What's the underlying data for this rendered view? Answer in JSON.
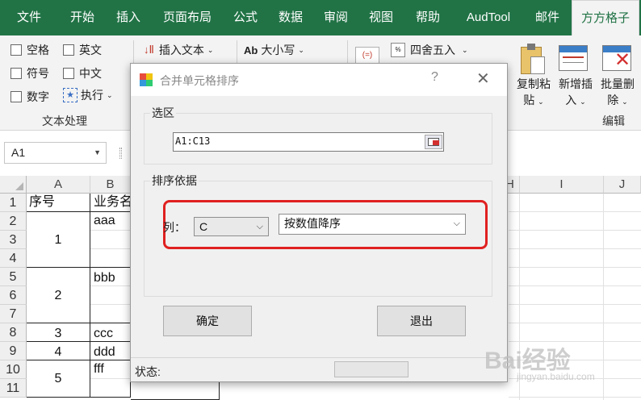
{
  "tabs": [
    "文件",
    "开始",
    "插入",
    "页面布局",
    "公式",
    "数据",
    "审阅",
    "视图",
    "帮助",
    "AudTool",
    "邮件",
    "方方格子"
  ],
  "ribbon": {
    "checkboxes": [
      "空格",
      "英文",
      "符号",
      "中文",
      "数字"
    ],
    "execute_label": "执行",
    "group_text_label": "文本处理",
    "insert_text_label": "插入文本",
    "case_label": "大小写",
    "case_icon_text": "Ab",
    "round_label": "四舍五入",
    "copy_paste_label_1": "复制粘",
    "copy_paste_label_2": "贴",
    "add_insert_label_1": "新增插",
    "add_insert_label_2": "入",
    "batch_delete_label_1": "批量删",
    "batch_delete_label_2": "除",
    "group_edit_label": "编辑"
  },
  "namebox": {
    "value": "A1"
  },
  "sheet": {
    "columns": [
      "A",
      "B",
      "H",
      "I",
      "J"
    ],
    "rows": [
      "1",
      "2",
      "3",
      "4",
      "5",
      "6",
      "7",
      "8",
      "9",
      "10",
      "11"
    ],
    "header_a": "序号",
    "header_b": "业务名",
    "a_values": [
      "1",
      "2",
      "3",
      "4",
      "5"
    ],
    "b_values": [
      "aaa",
      "bbb",
      "ccc",
      "ddd",
      "fff"
    ]
  },
  "dialog": {
    "title": "合并单元格排序",
    "help": "?",
    "close": "✕",
    "range_group_label": "选区",
    "range_value": "A1:C13",
    "sort_group_label": "排序依据",
    "column_label": "列：",
    "column_value": "C",
    "order_value": "按数值降序",
    "ok_label": "确定",
    "exit_label": "退出",
    "status_label": "状态:"
  },
  "watermark": {
    "brand": "Bai经验",
    "url": "jingyan.baidu.com"
  },
  "colors": {
    "ribbon_green": "#217346",
    "highlight_red": "#e02020"
  }
}
